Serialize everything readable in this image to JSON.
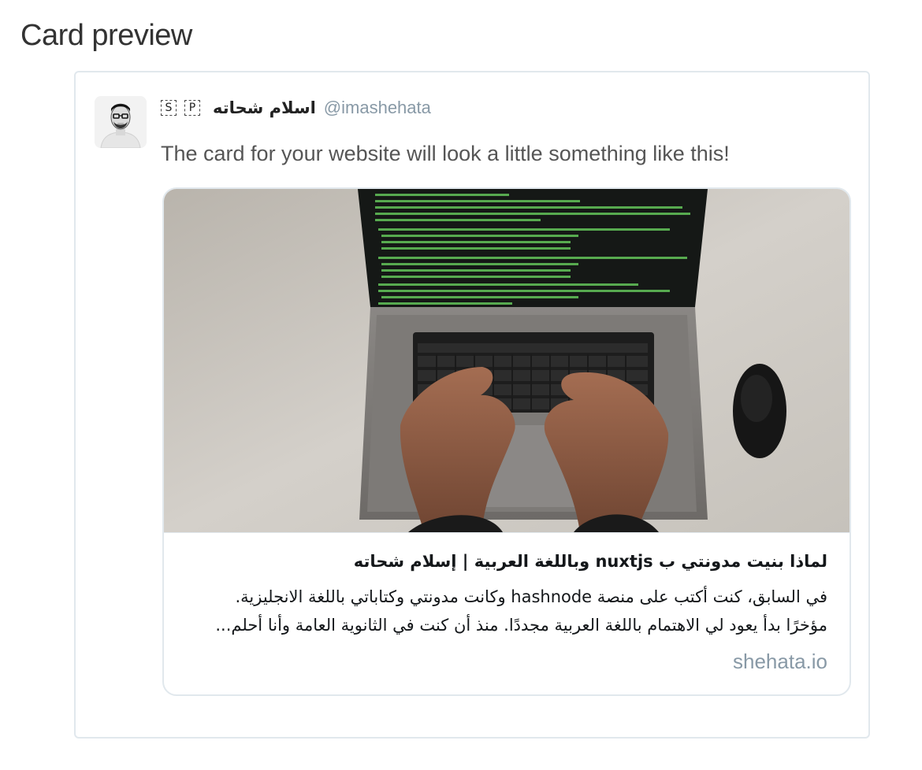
{
  "page": {
    "title": "Card preview"
  },
  "tweet": {
    "avatar_icon": "user-avatar-photo",
    "badges": [
      "S",
      "P"
    ],
    "display_name": "اسلام شحاته",
    "handle": "@imashehata",
    "text": "The card for your website will look a little something like this!"
  },
  "card": {
    "image_icon": "laptop-coding-photo",
    "title": "لماذا بنيت مدونتي ب nuxtjs وباللغة العربية | إسلام شحاته",
    "description_lines": [
      "في السابق، كنت أكتب على منصة hashnode وكانت مدونتي وكتاباتي باللغة الانجليزية.",
      "مؤخرًا بدأ يعود لي الاهتمام باللغة العربية مجددًا. منذ أن كنت في الثانوية العامة وأنا أحلم..."
    ],
    "domain": "shehata.io"
  },
  "colors": {
    "border": "#e1e8ed",
    "muted": "#8899a6",
    "text": "#14171a"
  }
}
